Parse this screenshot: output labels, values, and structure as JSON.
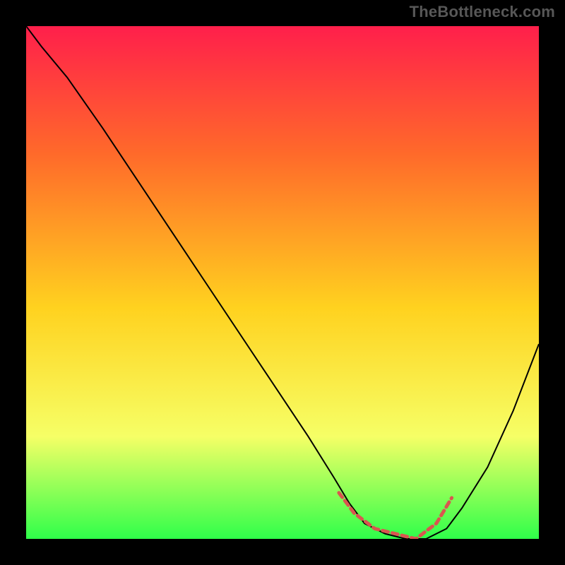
{
  "watermark": "TheBottleneck.com",
  "chart_data": {
    "type": "line",
    "title": "",
    "xlabel": "",
    "ylabel": "",
    "xlim": [
      0,
      100
    ],
    "ylim": [
      0,
      100
    ],
    "gradient_stops": [
      {
        "offset": 0,
        "color": "#ff1f4b"
      },
      {
        "offset": 25,
        "color": "#ff6a2a"
      },
      {
        "offset": 55,
        "color": "#ffd21f"
      },
      {
        "offset": 80,
        "color": "#f6ff66"
      },
      {
        "offset": 100,
        "color": "#2fff4a"
      }
    ],
    "series": [
      {
        "name": "curve",
        "stroke": "#000000",
        "stroke_width": 2,
        "x": [
          0,
          3,
          8,
          15,
          25,
          35,
          45,
          55,
          60,
          63,
          66,
          70,
          74,
          78,
          82,
          85,
          90,
          95,
          100
        ],
        "y": [
          100,
          96,
          90,
          80,
          65,
          50,
          35,
          20,
          12,
          7,
          3,
          1,
          0,
          0,
          2,
          6,
          14,
          25,
          38
        ]
      },
      {
        "name": "highlight-band",
        "stroke": "#d9564f",
        "stroke_width": 5,
        "x": [
          61,
          64,
          68,
          72,
          76,
          80,
          83
        ],
        "y": [
          9,
          5,
          2,
          1,
          0,
          3,
          8
        ]
      }
    ]
  }
}
